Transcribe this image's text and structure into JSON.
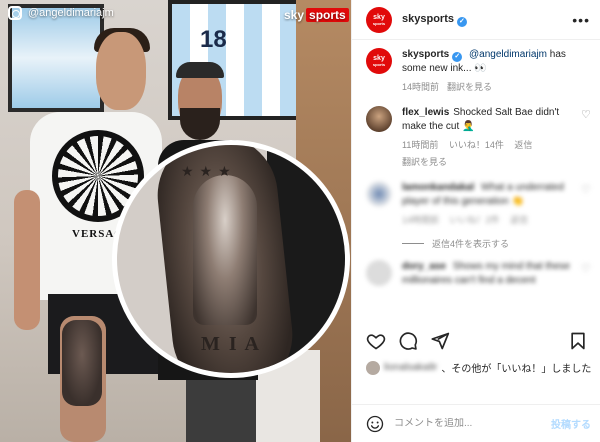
{
  "photo": {
    "username": "@angeldimariajm",
    "watermark": {
      "brand": "sky",
      "brand2": "sports"
    },
    "jersey_number": "18",
    "shirt_text": "VERSACE",
    "tattoo_text": "M I A"
  },
  "post": {
    "author": "skysports",
    "avatar_text": "sky",
    "avatar_sub": "sports",
    "more_label": "•••"
  },
  "comments": [
    {
      "user": "skysports",
      "mention": "@angeldimariajm",
      "text": " has some new ink... 👀",
      "time": "14時間前",
      "translate": "翻訳を見る"
    },
    {
      "user": "flex_lewis",
      "text": "Shocked Salt Bae didn't make the cut 🤦‍♂️",
      "time": "11時間前",
      "likes": "いいね！14件",
      "reply": "返信",
      "translate": "翻訳を見る"
    },
    {
      "user": "lamonkandakal",
      "text": "What a underrated player of this generation 👏",
      "time": "14時間前",
      "likes": "いいね！2件",
      "reply": "返信"
    },
    {
      "user": "dory_ase",
      "text": "Shows my mind that these millionaires can't find a decent"
    }
  ],
  "view_replies": "返信4件を表示する",
  "likes_line": {
    "blurred_user": "lionalsaka8r",
    "text": "、その他が「いいね！」しました"
  },
  "comment_box": {
    "placeholder": "コメントを追加...",
    "post_label": "投稿する"
  },
  "colors": {
    "brand_red": "#e10a0a",
    "verified_blue": "#3897f0",
    "post_button_disabled": "#b3dbff"
  }
}
